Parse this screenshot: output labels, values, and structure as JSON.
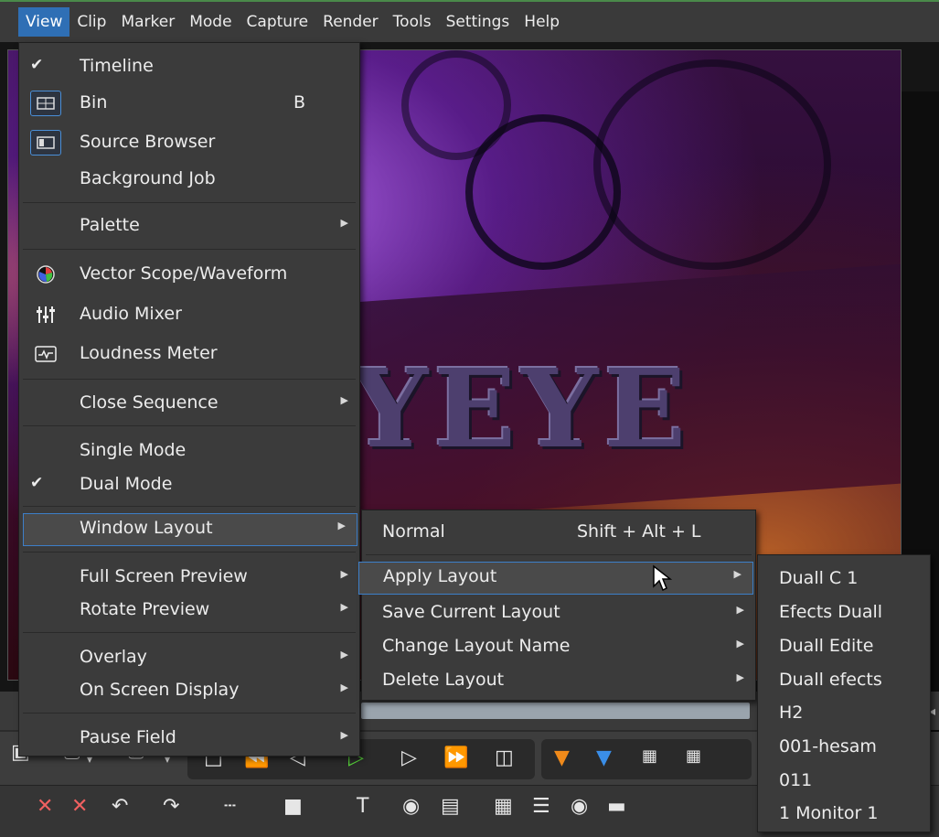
{
  "menubar": {
    "items": [
      "View",
      "Clip",
      "Marker",
      "Mode",
      "Capture",
      "Render",
      "Tools",
      "Settings",
      "Help"
    ],
    "active": "View"
  },
  "preview": {
    "overlay_text": "YEYE"
  },
  "view_menu": {
    "timeline": "Timeline",
    "bin": "Bin",
    "bin_shortcut": "B",
    "source_browser": "Source Browser",
    "background_job": "Background Job",
    "palette": "Palette",
    "vector_scope": "Vector Scope/Waveform",
    "audio_mixer": "Audio Mixer",
    "loudness_meter": "Loudness Meter",
    "close_sequence": "Close Sequence",
    "single_mode": "Single Mode",
    "dual_mode": "Dual Mode",
    "window_layout": "Window Layout",
    "full_screen_preview": "Full Screen Preview",
    "rotate_preview": "Rotate Preview",
    "overlay": "Overlay",
    "on_screen_display": "On Screen Display",
    "pause_field": "Pause Field"
  },
  "window_layout_menu": {
    "normal": "Normal",
    "normal_shortcut": "Shift + Alt + L",
    "apply_layout": "Apply Layout",
    "save_current_layout": "Save Current Layout",
    "change_layout_name": "Change Layout Name",
    "delete_layout": "Delete Layout"
  },
  "apply_layout_menu": {
    "items": [
      "Duall C 1",
      "Efects Duall",
      "Duall Edite",
      "Duall efects",
      "H2",
      "001-hesam",
      "011",
      "1 Monitor 1"
    ]
  },
  "colors": {
    "menubar_active": "#2f6fb5",
    "menu_bg": "#3b3b3b",
    "highlight_border": "#3d7fc8",
    "play_green": "#57d43a",
    "marker_orange": "#f08a1a",
    "marker_blue": "#3a8ee8"
  }
}
